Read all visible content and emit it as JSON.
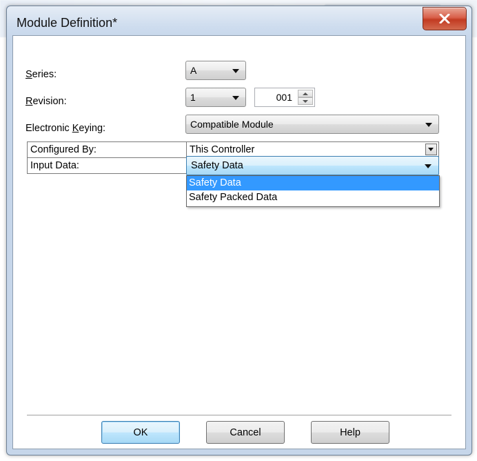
{
  "dialog": {
    "title": "Module Definition*",
    "close_icon": "close-x-icon"
  },
  "fields": {
    "series": {
      "label_prefix": "",
      "label_access": "S",
      "label_rest": "eries:",
      "value": "A"
    },
    "revision": {
      "label_access": "R",
      "label_rest": "evision:",
      "major": "1",
      "minor": "001"
    },
    "keying": {
      "label_prefix": "Electronic ",
      "label_access": "K",
      "label_rest": "eying:",
      "value": "Compatible Module"
    }
  },
  "property_grid": {
    "rows": [
      {
        "name": "Configured By:",
        "value": "This Controller"
      },
      {
        "name": "Input Data:",
        "value": "Safety Data"
      }
    ],
    "dropdown_options": [
      "Safety Data",
      "Safety Packed Data"
    ],
    "selected_option": "Safety Data"
  },
  "buttons": {
    "ok": "OK",
    "cancel": "Cancel",
    "help": "Help"
  },
  "colors": {
    "selection": "#3399ff",
    "close_button": "#c23b22",
    "frame": "#c6d6ea"
  }
}
